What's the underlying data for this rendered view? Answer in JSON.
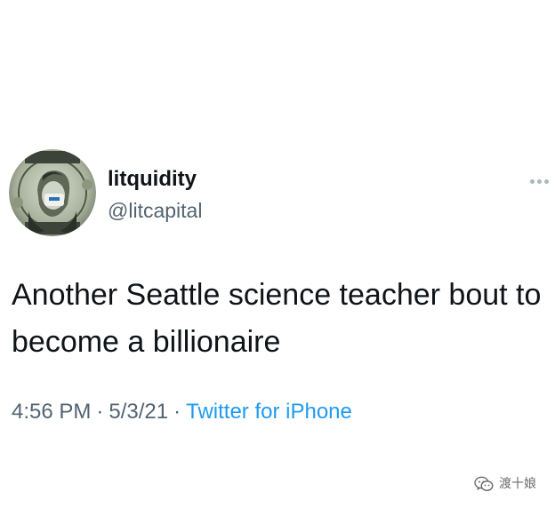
{
  "tweet": {
    "display_name": "litquidity",
    "handle": "@litcapital",
    "text": "Another Seattle science teacher bout to become a billionaire",
    "time": "4:56 PM",
    "date": "5/3/21",
    "source": "Twitter for iPhone",
    "separator": "·",
    "avatar": "dollar-bill-portrait-icon",
    "more": "more-dots-icon",
    "accent_color": "#1d9bf0"
  },
  "watermark": {
    "icon": "wechat-icon",
    "text": "渡十娘"
  }
}
